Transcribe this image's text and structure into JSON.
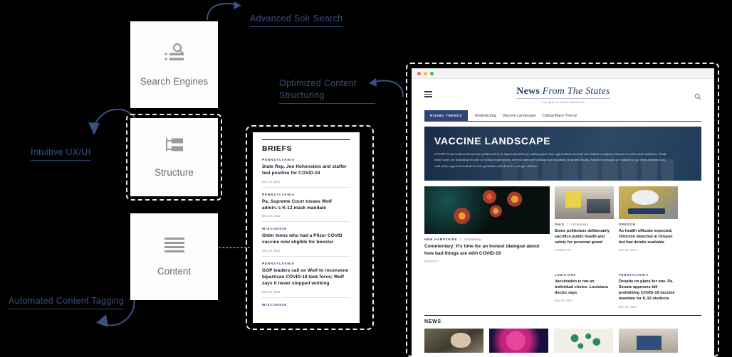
{
  "annotations": [
    {
      "id": "advanced-solr-search",
      "text": "Advanced Solr Search"
    },
    {
      "id": "optimized-content-structuring",
      "text": "Optimized Content\nStructuring"
    },
    {
      "id": "intuitive-ux-ui",
      "text": "Intuitive UX/UI"
    },
    {
      "id": "automated-content-tagging",
      "text": "Automated Content Tagging"
    }
  ],
  "feature_cards": [
    {
      "id": "search-engines",
      "label": "Search Engines",
      "icon": "search-list-icon"
    },
    {
      "id": "structure",
      "label": "Structure",
      "icon": "hierarchy-icon"
    },
    {
      "id": "content",
      "label": "Content",
      "icon": "lines-icon"
    }
  ],
  "briefs": {
    "title": "BRIEFS",
    "items": [
      {
        "state": "PENNSYLVANIA",
        "headline": "State Rep. Joe Hohenstein and staffer test positive for COVID-19",
        "date": "Dec 13, 2021"
      },
      {
        "state": "PENNSYLVANIA",
        "headline": "Pa. Supreme Court tosses Wolf admin.'s K-12 mask mandate",
        "date": "Dec 10, 2021"
      },
      {
        "state": "WISCONSIN",
        "headline": "Older teens who had a Pfizer COVID vaccine now eligible for booster",
        "date": "Dec 10, 2021"
      },
      {
        "state": "PENNSYLVANIA",
        "headline": "GOP leaders call on Wolf to reconvene bipartisan COVID-19 task force; Wolf says it never stopped working",
        "date": "Dec 10, 2021"
      },
      {
        "state": "WISCONSIN",
        "headline": "",
        "date": ""
      }
    ]
  },
  "browser": {
    "traffic_lights": [
      "#ff5f57",
      "#febc2e",
      "#28c840"
    ],
    "site": {
      "menu_icon": "hamburger-icon",
      "search_icon": "search-icon",
      "brand_name_bold": "News",
      "brand_name_italic": "From The States",
      "brand_subtitle": "A project of States Newsroom",
      "trending": {
        "pill": "RISING TRENDS",
        "links": [
          "Redistricting",
          "Vaccine Landscape",
          "Critical Race Theory"
        ]
      },
      "hero": {
        "title": "VACCINE LANDSCAPE",
        "body": "COVID-19 vaccination has become politicized in an unprecedented way and has given new opportunities for anti-vaccination conspiracy theories to reach wide audiences. While many states are instituting vaccine or testing requirements, several others are banning such mandates from their books. And those tensions are unlikely to go away anytime soon with newly approved federal booster guidelines and shots for younger children."
      },
      "featured_cards": [
        {
          "id": "card-commentary-honest-dialogue",
          "state": "NEW HAMPSHIRE",
          "kind": "Commentary",
          "headline": "Commentary: It's time for an honest dialogue about how bad things are with COVID-19",
          "date": "5:00am ET",
          "thumb": "virus-dark-field"
        },
        {
          "id": "card-politicians-personal-greed",
          "state": "OHIO",
          "kind": "Commentary",
          "headline": "Some politicians deliberately sacrifice public health and safety for personal greed",
          "date": "12:20am ET",
          "thumb": "hospital-ward"
        },
        {
          "id": "card-omicron-oregon",
          "state": "OREGON",
          "kind": "",
          "headline": "As health officials expected, Omicron detected in Oregon but few details available",
          "date": "Dec 13, 2021",
          "thumb": "lab-technician-vial"
        }
      ],
      "secondary_cards": [
        {
          "id": "card-louisiana-doctor",
          "state": "LOUISIANA",
          "kind": "",
          "headline": "Vaccination is not an individual choice, Louisiana doctor says",
          "date": "Dec 13, 2021"
        },
        {
          "id": "card-pa-senate-bill",
          "state": "PENNSYLVANIA",
          "kind": "",
          "headline": "Despite no plans for one, Pa. Senate approves bill prohibiting COVID-19 vaccine mandate for K-12 students",
          "date": "Dec 13, 2021"
        }
      ],
      "news_section": {
        "title": "NEWS",
        "thumbs": [
          "older-man-portrait",
          "pink-virus-closeup",
          "green-virus-particles",
          "hospital-corridor"
        ]
      }
    }
  },
  "colors": {
    "annotation": "#3c5182",
    "annotation_rule": "#2f4478",
    "brand_navy": "#1f3d6e",
    "trend_pill": "#2f4478",
    "card_bg": "#fdfdfd",
    "page_bg": "#000000"
  }
}
